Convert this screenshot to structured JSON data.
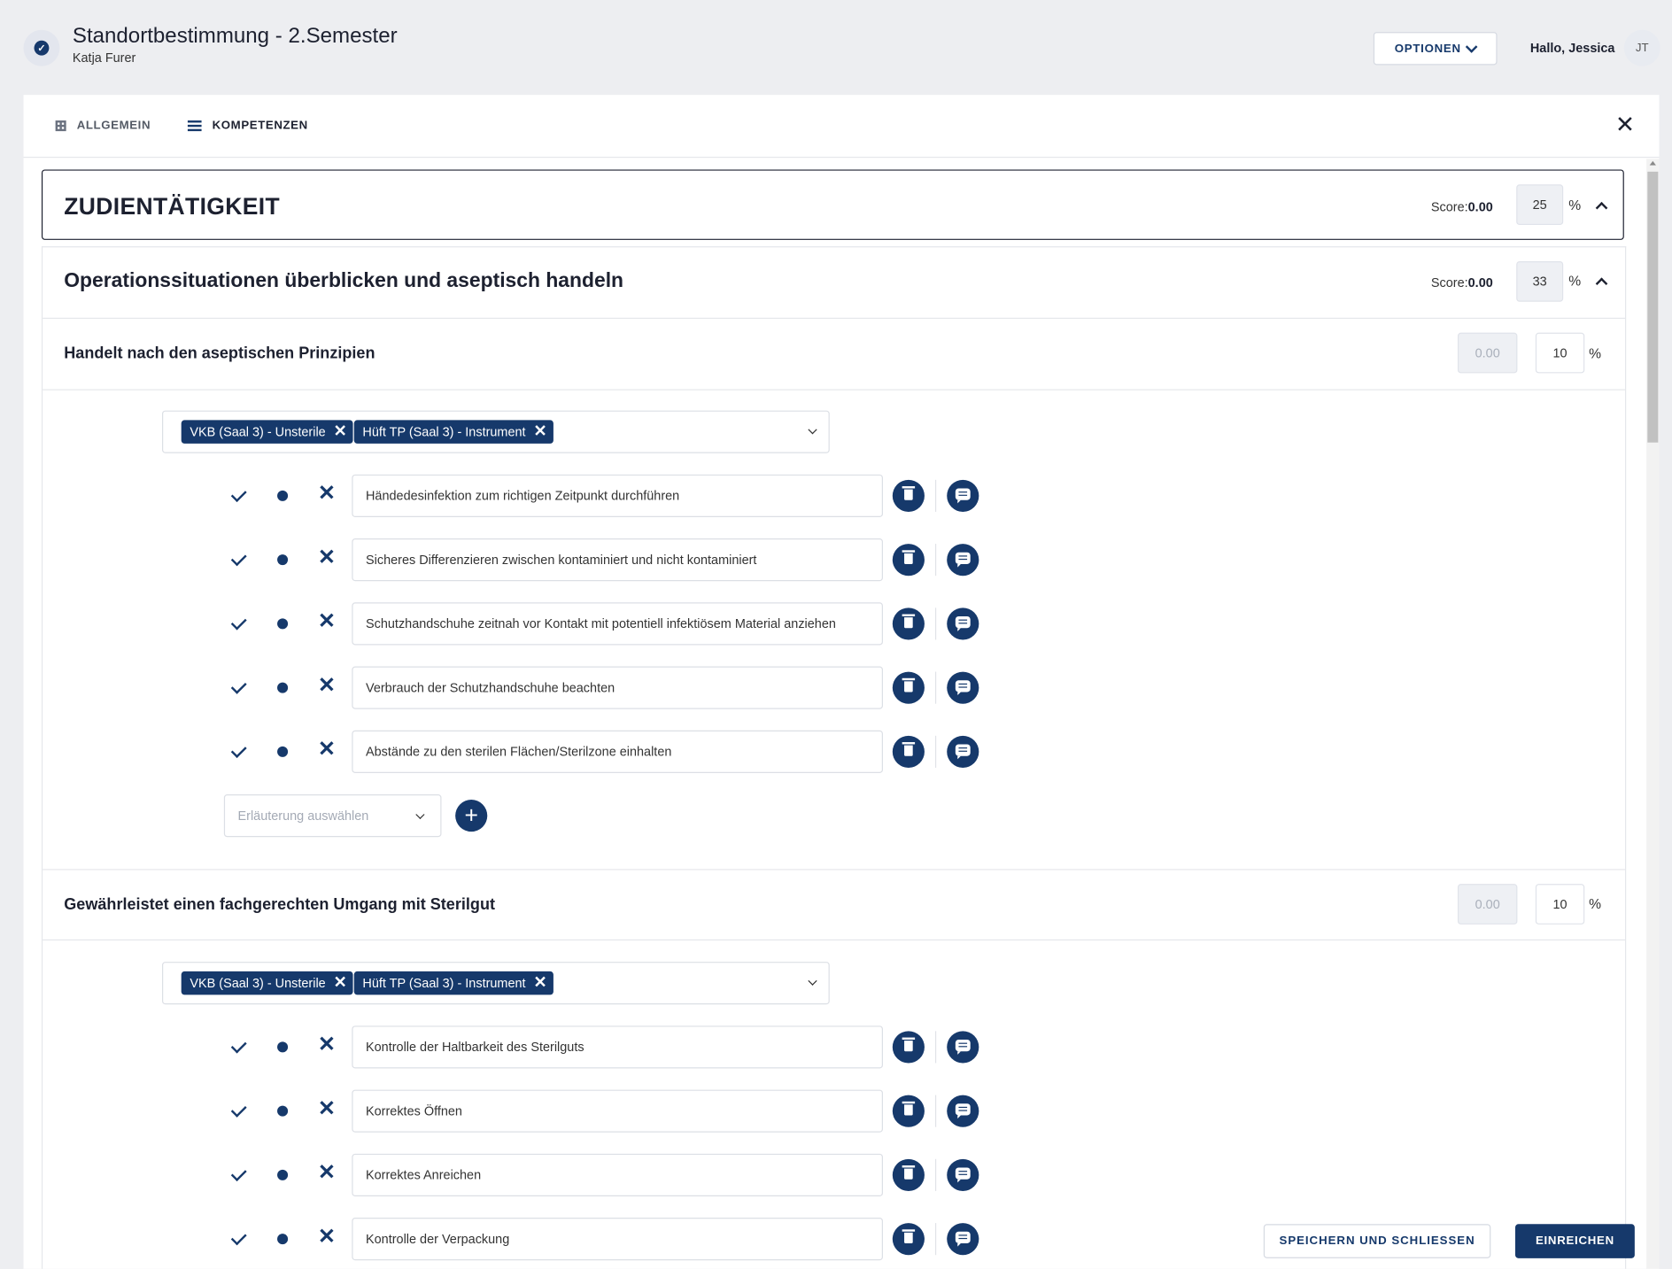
{
  "header": {
    "title": "Standortbestimmung - 2.Semester",
    "subtitle": "Katja Furer",
    "options_label": "OPTIONEN",
    "greeting": "Hallo, Jessica",
    "avatar_initials": "JT"
  },
  "tabs": [
    {
      "label": "ALLGEMEIN",
      "icon": "grid-icon"
    },
    {
      "label": "KOMPETENZEN",
      "icon": "list-icon",
      "active": true
    }
  ],
  "section": {
    "title": "ZUDIENTÄTIGKEIT",
    "score_label": "Score:",
    "score_value": "0.00",
    "percent": "25",
    "percent_sign": "%"
  },
  "subsection": {
    "title": "Operationssituationen überblicken und aseptisch handeln",
    "score_label": "Score:",
    "score_value": "0.00",
    "percent": "33",
    "percent_sign": "%"
  },
  "competencies": [
    {
      "title": "Handelt nach den aseptischen Prinzipien",
      "score": "0.00",
      "percent": "10",
      "percent_sign": "%",
      "tags": [
        "VKB (Saal 3) - Unsterile",
        "Hüft TP (Saal 3) - Instrument"
      ],
      "criteria": [
        "Händedesinfektion zum richtigen Zeitpunkt durchführen",
        "Sicheres Differenzieren zwischen kontaminiert und nicht kontaminiert",
        "Schutzhandschuhe zeitnah vor Kontakt mit potentiell infektiösem Material anziehen",
        "Verbrauch der Schutzhandschuhe beachten",
        "Abstände zu den sterilen Flächen/Sterilzone einhalten"
      ],
      "explanation_placeholder": "Erläuterung auswählen",
      "add_symbol": "+"
    },
    {
      "title": "Gewährleistet einen fachgerechten Umgang mit Sterilgut",
      "score": "0.00",
      "percent": "10",
      "percent_sign": "%",
      "tags": [
        "VKB (Saal 3) - Unsterile",
        "Hüft TP (Saal 3) - Instrument"
      ],
      "criteria": [
        "Kontrolle der Haltbarkeit des Sterilguts",
        "Korrektes Öffnen",
        "Korrektes Anreichen",
        "Kontrolle der Verpackung"
      ]
    }
  ],
  "footer": {
    "save_close_label": "SPEICHERN UND SCHLIESSEN",
    "submit_label": "EINREICHEN"
  },
  "colors": {
    "primary": "#16396b",
    "background": "#edeef1"
  }
}
